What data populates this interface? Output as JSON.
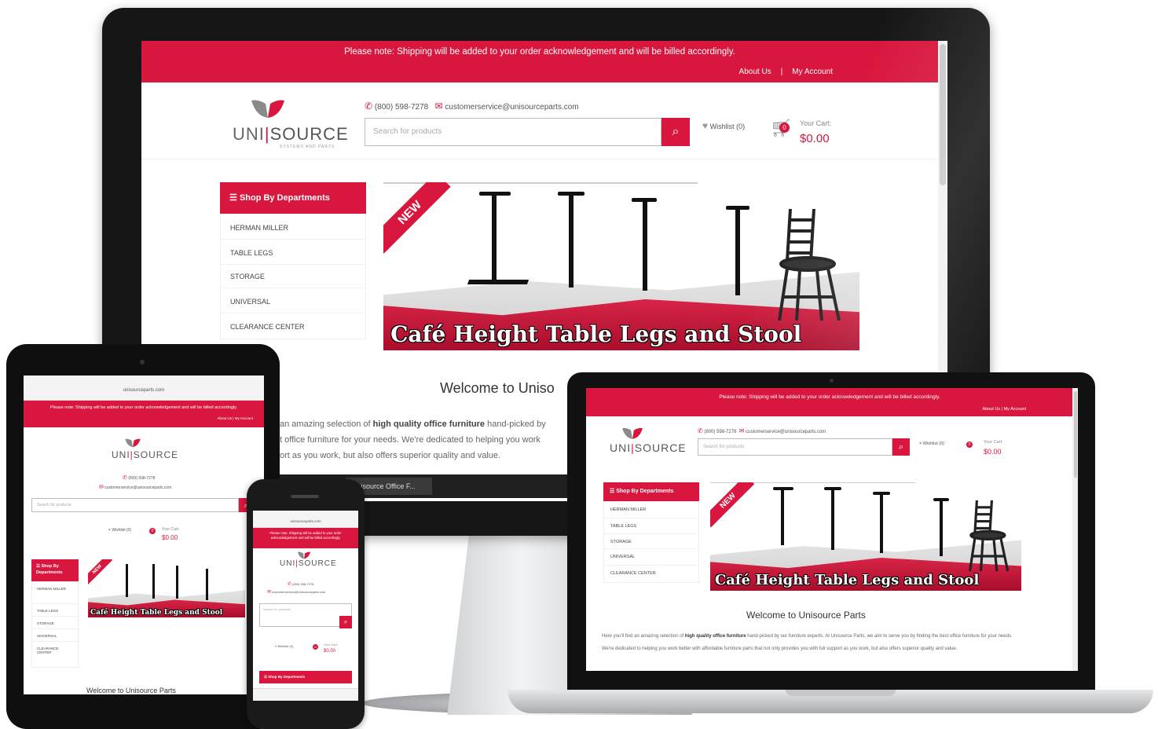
{
  "site": {
    "notice": "Please note: Shipping will be added to your order acknowledgement and will be billed accordingly.",
    "top_links": [
      "About Us",
      "|",
      "My Account"
    ],
    "logo": {
      "part1": "UNI",
      "sep": "|",
      "part2": "SOURCE",
      "tagline": "SYSTEMS AND PARTS"
    },
    "phone": "(800) 598-7278",
    "email": "customerservice@unisourceparts.com",
    "search_placeholder": "Search for products",
    "wishlist_label": "Wishlist (0)",
    "cart_count": "0",
    "cart_label": "Your Cart:",
    "cart_total": "$0.00",
    "departments_title": "Shop By Departments",
    "departments": [
      "HERMAN MILLER",
      "TABLE LEGS",
      "STORAGE",
      "UNIVERSAL",
      "CLEARANCE CENTER"
    ],
    "banner_badge": "NEW",
    "banner_title": "Café Height Table Legs and Stool",
    "welcome": "Welcome to Unisource Parts",
    "welcome_clipped": "Welcome to Uniso",
    "intro_plain_1": "Here you'll find an amazing selection of ",
    "intro_bold": "high quality office furniture",
    "intro_plain_2": " hand-picked by our furniture experts. At Unisource Parts, we aim to serve you by finding the best office furniture for your needs. We're dedicated to helping you work better with affordable furniture parts that not only provides you with full support as you work, but also offers superior quality and value.",
    "monitor_lines": [
      "an amazing selection of ",
      "high quality office furniture",
      " hand-picked by",
      "t office furniture for your needs. We're dedicated to helping you work",
      "ort as you work, but also offers superior quality and value."
    ],
    "taskbar_item": "Unisource Office F...",
    "tablet_url": "unisourceparts.com",
    "phone_url": "unisourceparts.com",
    "tablet_departments_title": "Shop By Departments",
    "phone_departments_title": "Shop By Departments"
  },
  "colors": {
    "brand_red": "#d9163d",
    "dark_red": "#a80e2c",
    "bezel": "#161616"
  },
  "icons": [
    "phone-icon",
    "mail-icon",
    "search-icon",
    "heart-icon",
    "cart-icon",
    "menu-icon",
    "stool-image",
    "logo-mark"
  ]
}
